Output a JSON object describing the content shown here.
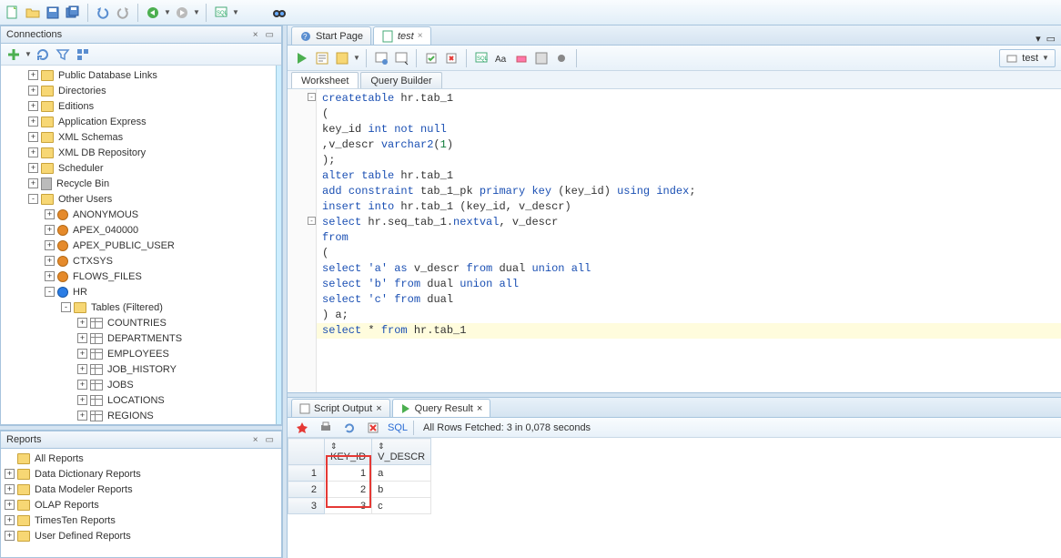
{
  "connections": {
    "title": "Connections",
    "nodes": [
      {
        "label": "Public Database Links",
        "icon": "folder",
        "exp": "+",
        "indent": 30
      },
      {
        "label": "Directories",
        "icon": "folder",
        "exp": "+",
        "indent": 30
      },
      {
        "label": "Editions",
        "icon": "folder",
        "exp": "+",
        "indent": 30
      },
      {
        "label": "Application Express",
        "icon": "folder",
        "exp": "+",
        "indent": 30
      },
      {
        "label": "XML Schemas",
        "icon": "schema",
        "exp": "+",
        "indent": 30
      },
      {
        "label": "XML DB Repository",
        "icon": "folder",
        "exp": "+",
        "indent": 30
      },
      {
        "label": "Scheduler",
        "icon": "folder",
        "exp": "+",
        "indent": 30
      },
      {
        "label": "Recycle Bin",
        "icon": "bin",
        "exp": "+",
        "indent": 30
      },
      {
        "label": "Other Users",
        "icon": "folder",
        "exp": "-",
        "indent": 30
      },
      {
        "label": "ANONYMOUS",
        "icon": "user",
        "exp": "+",
        "indent": 48
      },
      {
        "label": "APEX_040000",
        "icon": "user",
        "exp": "+",
        "indent": 48
      },
      {
        "label": "APEX_PUBLIC_USER",
        "icon": "user",
        "exp": "+",
        "indent": 48
      },
      {
        "label": "CTXSYS",
        "icon": "user",
        "exp": "+",
        "indent": 48
      },
      {
        "label": "FLOWS_FILES",
        "icon": "user",
        "exp": "+",
        "indent": 48
      },
      {
        "label": "HR",
        "icon": "user-blue",
        "exp": "-",
        "indent": 48
      },
      {
        "label": "Tables (Filtered)",
        "icon": "folder",
        "exp": "-",
        "indent": 66
      },
      {
        "label": "COUNTRIES",
        "icon": "table",
        "exp": "+",
        "indent": 84
      },
      {
        "label": "DEPARTMENTS",
        "icon": "table",
        "exp": "+",
        "indent": 84
      },
      {
        "label": "EMPLOYEES",
        "icon": "table",
        "exp": "+",
        "indent": 84
      },
      {
        "label": "JOB_HISTORY",
        "icon": "table",
        "exp": "+",
        "indent": 84
      },
      {
        "label": "JOBS",
        "icon": "table",
        "exp": "+",
        "indent": 84
      },
      {
        "label": "LOCATIONS",
        "icon": "table",
        "exp": "+",
        "indent": 84
      },
      {
        "label": "REGIONS",
        "icon": "table",
        "exp": "+",
        "indent": 84
      }
    ]
  },
  "reports": {
    "title": "Reports",
    "nodes": [
      {
        "label": "All Reports",
        "icon": "folder",
        "exp": "",
        "indent": 4
      },
      {
        "label": "Data Dictionary Reports",
        "icon": "folder",
        "exp": "+",
        "indent": 4
      },
      {
        "label": "Data Modeler Reports",
        "icon": "folder",
        "exp": "+",
        "indent": 4
      },
      {
        "label": "OLAP Reports",
        "icon": "folder",
        "exp": "+",
        "indent": 4
      },
      {
        "label": "TimesTen Reports",
        "icon": "folder",
        "exp": "+",
        "indent": 4
      },
      {
        "label": "User Defined Reports",
        "icon": "folder",
        "exp": "+",
        "indent": 4
      }
    ]
  },
  "editor": {
    "tabs": [
      {
        "label": "Start Page",
        "icon": "start"
      },
      {
        "label": "test",
        "icon": "sql",
        "italic": true,
        "closable": true
      }
    ],
    "sub_tabs": [
      {
        "label": "Worksheet"
      },
      {
        "label": "Query Builder"
      }
    ],
    "conn_selector": "test",
    "code_lines": [
      {
        "t": [
          [
            "kw",
            "create"
          ],
          [
            "",
            ""
          ],
          [
            "kw",
            "table"
          ],
          [
            "",
            " hr.tab_1"
          ]
        ],
        "fold": "-"
      },
      {
        "t": [
          [
            "",
            "("
          ]
        ]
      },
      {
        "t": [
          [
            "",
            "key_id "
          ],
          [
            "kw",
            "int"
          ],
          [
            "",
            " "
          ],
          [
            "kw",
            "not"
          ],
          [
            "",
            " "
          ],
          [
            "kw",
            "null"
          ]
        ]
      },
      {
        "t": [
          [
            "",
            ",v_descr "
          ],
          [
            "kw",
            "varchar2"
          ],
          [
            "",
            "("
          ],
          [
            "lit",
            "1"
          ],
          [
            "",
            ")"
          ]
        ]
      },
      {
        "t": [
          [
            "",
            ");"
          ]
        ]
      },
      {
        "t": [
          [
            "kw",
            "alter"
          ],
          [
            "",
            " "
          ],
          [
            "kw",
            "table"
          ],
          [
            "",
            " hr.tab_1"
          ]
        ]
      },
      {
        "t": [
          [
            "kw",
            "add"
          ],
          [
            "",
            " "
          ],
          [
            "kw",
            "constraint"
          ],
          [
            "",
            " tab_1_pk "
          ],
          [
            "kw",
            "primary"
          ],
          [
            "",
            " "
          ],
          [
            "kw",
            "key"
          ],
          [
            "",
            " (key_id) "
          ],
          [
            "kw",
            "using"
          ],
          [
            "",
            " "
          ],
          [
            "kw",
            "index"
          ],
          [
            "",
            ";"
          ]
        ]
      },
      {
        "t": [
          [
            "",
            ""
          ]
        ]
      },
      {
        "t": [
          [
            "kw",
            "insert"
          ],
          [
            "",
            " "
          ],
          [
            "kw",
            "into"
          ],
          [
            "",
            " hr.tab_1 (key_id, v_descr)"
          ]
        ],
        "fold": "-"
      },
      {
        "t": [
          [
            "kw",
            "select"
          ],
          [
            "",
            " hr.seq_tab_1."
          ],
          [
            "kw",
            "nextval"
          ],
          [
            "",
            ", v_descr"
          ]
        ]
      },
      {
        "t": [
          [
            "kw",
            "from"
          ]
        ]
      },
      {
        "t": [
          [
            "",
            "("
          ]
        ]
      },
      {
        "t": [
          [
            "kw",
            "select"
          ],
          [
            "",
            " "
          ],
          [
            "str",
            "'a'"
          ],
          [
            "",
            " "
          ],
          [
            "kw",
            "as"
          ],
          [
            "",
            " v_descr "
          ],
          [
            "kw",
            "from"
          ],
          [
            "",
            " dual "
          ],
          [
            "kw",
            "union"
          ],
          [
            "",
            " "
          ],
          [
            "kw",
            "all"
          ]
        ]
      },
      {
        "t": [
          [
            "kw",
            "select"
          ],
          [
            "",
            " "
          ],
          [
            "str",
            "'b'"
          ],
          [
            "",
            " "
          ],
          [
            "kw",
            "from"
          ],
          [
            "",
            " dual "
          ],
          [
            "kw",
            "union"
          ],
          [
            "",
            " "
          ],
          [
            "kw",
            "all"
          ]
        ]
      },
      {
        "t": [
          [
            "kw",
            "select"
          ],
          [
            "",
            " "
          ],
          [
            "str",
            "'c'"
          ],
          [
            "",
            " "
          ],
          [
            "kw",
            "from"
          ],
          [
            "",
            " dual"
          ]
        ]
      },
      {
        "t": [
          [
            "",
            ") a;"
          ]
        ],
        "hl": true
      },
      {
        "t": [
          [
            "",
            ""
          ]
        ]
      },
      {
        "t": [
          [
            "kw",
            "select"
          ],
          [
            "",
            " * "
          ],
          [
            "kw",
            "from"
          ],
          [
            "",
            " hr.tab_1"
          ]
        ]
      }
    ]
  },
  "results": {
    "tabs": [
      {
        "label": "Script Output",
        "icon": "script"
      },
      {
        "label": "Query Result",
        "icon": "play"
      }
    ],
    "sql_label": "SQL",
    "status": "All Rows Fetched: 3 in 0,078 seconds",
    "columns": [
      "KEY_ID",
      "V_DESCR"
    ],
    "rows": [
      {
        "n": 1,
        "key_id": 1,
        "v_descr": "a"
      },
      {
        "n": 2,
        "key_id": 2,
        "v_descr": "b"
      },
      {
        "n": 3,
        "key_id": 3,
        "v_descr": "c"
      }
    ]
  }
}
